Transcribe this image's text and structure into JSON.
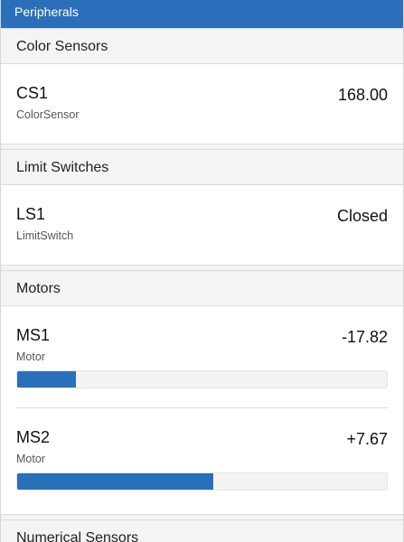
{
  "titlebar": {
    "title": "Peripherals"
  },
  "sections": {
    "color_sensors": {
      "title": "Color Sensors",
      "items": [
        {
          "name": "CS1",
          "type": "ColorSensor",
          "value": "168.00"
        }
      ]
    },
    "limit_switches": {
      "title": "Limit Switches",
      "items": [
        {
          "name": "LS1",
          "type": "LimitSwitch",
          "value": "Closed"
        }
      ]
    },
    "motors": {
      "title": "Motors",
      "items": [
        {
          "name": "MS1",
          "type": "Motor",
          "value": "-17.82",
          "bar_fraction": 0.16
        },
        {
          "name": "MS2",
          "type": "Motor",
          "value": "+7.67",
          "bar_fraction": 0.53
        }
      ]
    },
    "numerical_sensors": {
      "title": "Numerical Sensors"
    }
  },
  "colors": {
    "accent": "#2a6fba",
    "section_bg": "#f4f4f4"
  }
}
